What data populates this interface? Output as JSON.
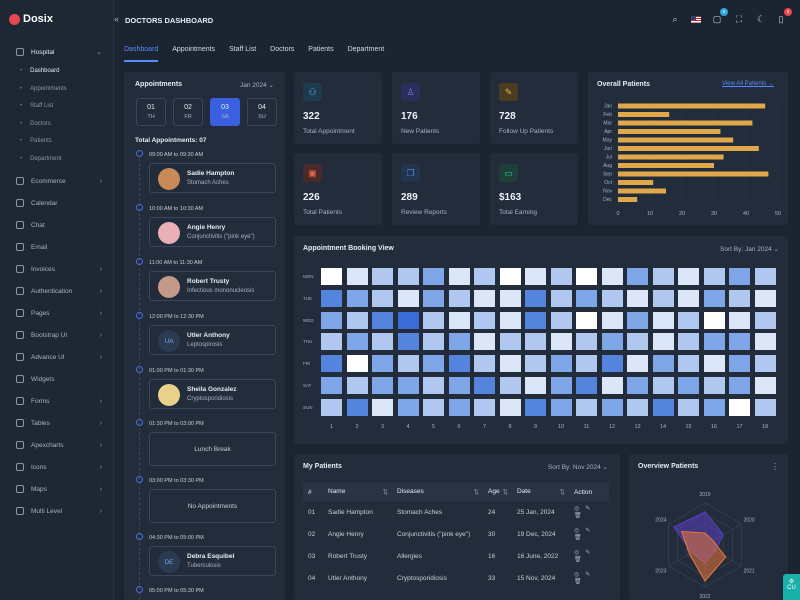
{
  "app": {
    "name": "Dosix",
    "page_title": "DOCTORS DASHBOARD"
  },
  "sidebar": {
    "hospital": "Hospital",
    "hospital_sub": [
      "Dashboard",
      "Appointments",
      "Staff List",
      "Doctors",
      "Patients",
      "Department"
    ],
    "items": [
      {
        "label": "Ecommerce",
        "chevron": true
      },
      {
        "label": "Calendar",
        "chevron": false
      },
      {
        "label": "Chat",
        "chevron": false
      },
      {
        "label": "Email",
        "chevron": false
      },
      {
        "label": "Invoices",
        "chevron": true
      },
      {
        "label": "Authentication",
        "chevron": true
      },
      {
        "label": "Pages",
        "chevron": true
      },
      {
        "label": "Bootstrap UI",
        "chevron": true
      },
      {
        "label": "Advance UI",
        "chevron": true
      },
      {
        "label": "Widgets",
        "chevron": false
      },
      {
        "label": "Forms",
        "chevron": true
      },
      {
        "label": "Tables",
        "chevron": true
      },
      {
        "label": "Apexcharts",
        "chevron": true
      },
      {
        "label": "Icons",
        "chevron": true
      },
      {
        "label": "Maps",
        "chevron": true
      },
      {
        "label": "Multi Level",
        "chevron": true
      }
    ]
  },
  "topbar": {
    "cart_badge": "5",
    "notif_badge": "3"
  },
  "tabs": [
    "Dashboard",
    "Appointments",
    "Staff List",
    "Doctors",
    "Patients",
    "Department"
  ],
  "appointments": {
    "title": "Appointments",
    "month": "Jan 2024",
    "dates": [
      {
        "num": "01",
        "day": "TH"
      },
      {
        "num": "02",
        "day": "FR"
      },
      {
        "num": "03",
        "day": "SA"
      },
      {
        "num": "04",
        "day": "SU"
      }
    ],
    "total": "Total Appointments: 07",
    "slots": [
      {
        "time": "09:00 AM to 09:30 AM",
        "name": "Sadie Hampton",
        "disease": "Stomach Aches",
        "avatar": "photo",
        "color": "#c98a5a"
      },
      {
        "time": "10:00 AM to 10:30 AM",
        "name": "Angie Henry",
        "disease": "Conjunctivitis (\"pink eye\")",
        "avatar": "photo",
        "color": "#e9b0b8"
      },
      {
        "time": "11:00 AM to 11:30 AM",
        "name": "Robert Trusty",
        "disease": "Infectious mononucleosis",
        "avatar": "photo",
        "color": "#c49a86"
      },
      {
        "time": "12:00 PM to 12:30 PM",
        "name": "Utler Anthony",
        "disease": "Leptospirosis",
        "avatar": "UA",
        "color": "#2a3b52"
      },
      {
        "time": "01:00 PM to 01:30 PM",
        "name": "Sheila Gonzalez",
        "disease": "Cryptosporidiosis",
        "avatar": "photo",
        "color": "#e8d28a"
      },
      {
        "time": "01:30 PM to 03:00 PM",
        "center": "Lunch Break"
      },
      {
        "time": "03:00 PM to 03:30 PM",
        "center": "No Appointments"
      },
      {
        "time": "04:30 PM to 05:00 PM",
        "name": "Debra Esquibel",
        "disease": "Tuberculosis",
        "avatar": "DE",
        "color": "#2a3b52"
      },
      {
        "time": "05:00 PM to 05:30 PM"
      }
    ]
  },
  "stats": [
    {
      "value": "322",
      "label": "Total Appointment",
      "icon": "users-icon",
      "color": "#4db6e8",
      "bg": "#1f3a4d"
    },
    {
      "value": "176",
      "label": "New Patients",
      "icon": "user-icon",
      "color": "#7a7df0",
      "bg": "#2a2e5a"
    },
    {
      "value": "728",
      "label": "Follow Up Patients",
      "icon": "leaf-icon",
      "color": "#e8b04a",
      "bg": "#4a3d22"
    },
    {
      "value": "226",
      "label": "Total Patients",
      "icon": "monitor-icon",
      "color": "#e8654a",
      "bg": "#4a2a28"
    },
    {
      "value": "289",
      "label": "Review Reports",
      "icon": "copy-icon",
      "color": "#4a8ae8",
      "bg": "#22354d"
    },
    {
      "value": "$163",
      "label": "Total Earning",
      "icon": "card-icon",
      "color": "#2ec4a0",
      "bg": "#1e4038"
    }
  ],
  "overall": {
    "title": "Overall Patients",
    "link": "View All Patients →",
    "chart_data": {
      "type": "bar",
      "orientation": "horizontal",
      "categories": [
        "Jan",
        "Feb",
        "Mar",
        "Apr",
        "May",
        "Jun",
        "Jul",
        "Aug",
        "Sep",
        "Oct",
        "Nov",
        "Dec"
      ],
      "values": [
        46,
        16,
        42,
        32,
        36,
        44,
        33,
        30,
        47,
        11,
        15,
        6
      ],
      "xticks": [
        "0",
        "10",
        "20",
        "30",
        "40",
        "50"
      ],
      "xlim": [
        0,
        50
      ],
      "color": "#e0a84a"
    }
  },
  "booking": {
    "title": "Appointment Booking View",
    "sort_label": "Sort By:",
    "sort_value": "Jan 2024",
    "chart_data": {
      "type": "heatmap",
      "rows": [
        "MON",
        "TUE",
        "WED",
        "THU",
        "FRI",
        "SAT",
        "SUN"
      ],
      "columns": [
        "1",
        "2",
        "3",
        "4",
        "5",
        "6",
        "7",
        "8",
        "9",
        "10",
        "11",
        "12",
        "13",
        "14",
        "15",
        "16",
        "17",
        "18"
      ],
      "levels": [
        [
          0,
          1,
          2,
          2,
          3,
          1,
          2,
          0,
          1,
          2,
          0,
          1,
          3,
          2,
          1,
          2,
          3,
          2
        ],
        [
          4,
          3,
          2,
          1,
          3,
          2,
          1,
          1,
          4,
          2,
          3,
          2,
          1,
          2,
          1,
          3,
          2,
          1
        ],
        [
          3,
          2,
          4,
          5,
          2,
          1,
          2,
          1,
          4,
          2,
          0,
          1,
          3,
          1,
          2,
          0,
          1,
          2
        ],
        [
          2,
          3,
          2,
          4,
          2,
          3,
          1,
          2,
          2,
          1,
          2,
          3,
          2,
          1,
          2,
          3,
          3,
          1
        ],
        [
          4,
          0,
          3,
          2,
          3,
          4,
          2,
          1,
          2,
          3,
          2,
          4,
          1,
          3,
          2,
          1,
          3,
          2
        ],
        [
          3,
          2,
          3,
          3,
          2,
          3,
          4,
          2,
          1,
          3,
          4,
          1,
          3,
          2,
          3,
          2,
          3,
          1
        ],
        [
          2,
          4,
          1,
          3,
          2,
          3,
          2,
          1,
          4,
          3,
          2,
          3,
          2,
          4,
          2,
          3,
          0,
          2
        ]
      ],
      "palette": [
        "#ffffff",
        "#dbe6f8",
        "#b0c8f0",
        "#7fa6e6",
        "#5584dc",
        "#3a6cd6"
      ]
    }
  },
  "patients": {
    "title": "My Patients",
    "sort_label": "Sort By:",
    "sort_value": "Nov 2024",
    "columns": [
      "#",
      "Name",
      "Diseases",
      "Age",
      "Date",
      "Action"
    ],
    "rows": [
      [
        "01",
        "Sadie Hampton",
        "Stomach Aches",
        "24",
        "25 Jan, 2024"
      ],
      [
        "02",
        "Angie Henry",
        "Conjunctivitis (\"pink eye\")",
        "30",
        "19 Dec, 2024"
      ],
      [
        "03",
        "Robert Trusty",
        "Allergies",
        "16",
        "16 June, 2022"
      ],
      [
        "04",
        "Utler Anthony",
        "Cryptosporidiosis",
        "33",
        "15 Nov, 2024"
      ]
    ]
  },
  "overview": {
    "title": "Overview Patients",
    "chart_data": {
      "type": "radar",
      "axes": [
        "2019",
        "2020",
        "2021",
        "2022",
        "2023",
        "2024"
      ],
      "series": [
        {
          "values": [
            55,
            35,
            20,
            30,
            25,
            60
          ],
          "color": "#5a3fc0"
        },
        {
          "values": [
            20,
            15,
            40,
            60,
            30,
            45
          ],
          "color": "#e8763a"
        }
      ]
    }
  },
  "helper_tab": "CU"
}
